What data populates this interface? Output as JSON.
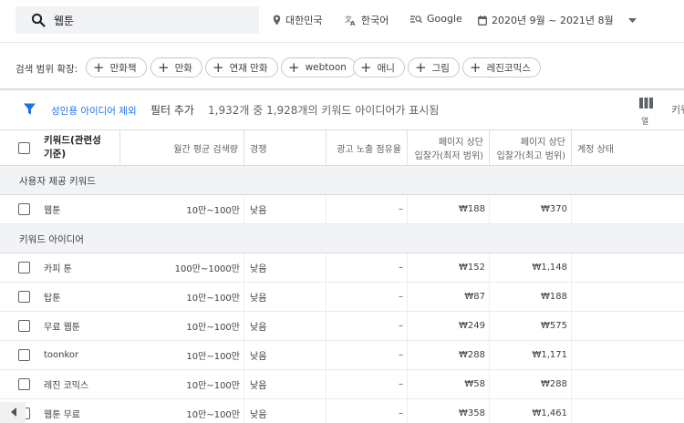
{
  "search": {
    "value": "웹툰",
    "placeholder": ""
  },
  "filters": {
    "location": "대한민국",
    "language": "한국어",
    "network": "Google",
    "date_range": "2020년 9월 ~ 2021년 8월"
  },
  "expand": {
    "label": "검색 범위 확장:",
    "chips": [
      "만화책",
      "만화",
      "연재 만화",
      "webtoon",
      "애니",
      "그림",
      "레진코믹스"
    ]
  },
  "filterbar": {
    "adult_filter": "성인용 아이디어 제외",
    "add_filter": "필터 추가",
    "count": "1,932개 중 1,928개의 키워드 아이디어가 표시됨",
    "columns_label": "열",
    "keyword_partial": "키워"
  },
  "table": {
    "headers": {
      "keyword": [
        "키워드(관련성",
        "기준)"
      ],
      "avg_searches": "월간 평균 검색량",
      "competition": "경쟁",
      "impression_share": "광고 노출 점유율",
      "bid_low": [
        "페이지 상단",
        "입찰가(최저 범위)"
      ],
      "bid_high": [
        "페이지 상단",
        "입찰가(최고 범위)"
      ],
      "account_status": "계정 상태"
    },
    "sections": [
      {
        "title": "사용자 제공 키워드",
        "rows": [
          {
            "keyword": "웹툰",
            "avg": "10만~100만",
            "comp": "낮음",
            "share": "–",
            "low": "₩188",
            "high": "₩370"
          }
        ]
      },
      {
        "title": "키워드 아이디어",
        "rows": [
          {
            "keyword": "카피 툰",
            "avg": "100만~1000만",
            "comp": "낮음",
            "share": "–",
            "low": "₩152",
            "high": "₩1,148"
          },
          {
            "keyword": "탑툰",
            "avg": "10만~100만",
            "comp": "낮음",
            "share": "–",
            "low": "₩87",
            "high": "₩188"
          },
          {
            "keyword": "무료 웹툰",
            "avg": "10만~100만",
            "comp": "낮음",
            "share": "–",
            "low": "₩249",
            "high": "₩575"
          },
          {
            "keyword": "toonkor",
            "avg": "10만~100만",
            "comp": "낮음",
            "share": "–",
            "low": "₩288",
            "high": "₩1,171"
          },
          {
            "keyword": "레진 코믹스",
            "avg": "10만~100만",
            "comp": "낮음",
            "share": "–",
            "low": "₩58",
            "high": "₩288"
          },
          {
            "keyword": "웹툰 무료",
            "avg": "10만~100만",
            "comp": "낮음",
            "share": "–",
            "low": "₩358",
            "high": "₩1,461"
          }
        ]
      }
    ]
  },
  "colors": {
    "accent": "#1a73e8",
    "section_bg": "#f1f3f4",
    "search_bg": "#f1f3f4"
  }
}
